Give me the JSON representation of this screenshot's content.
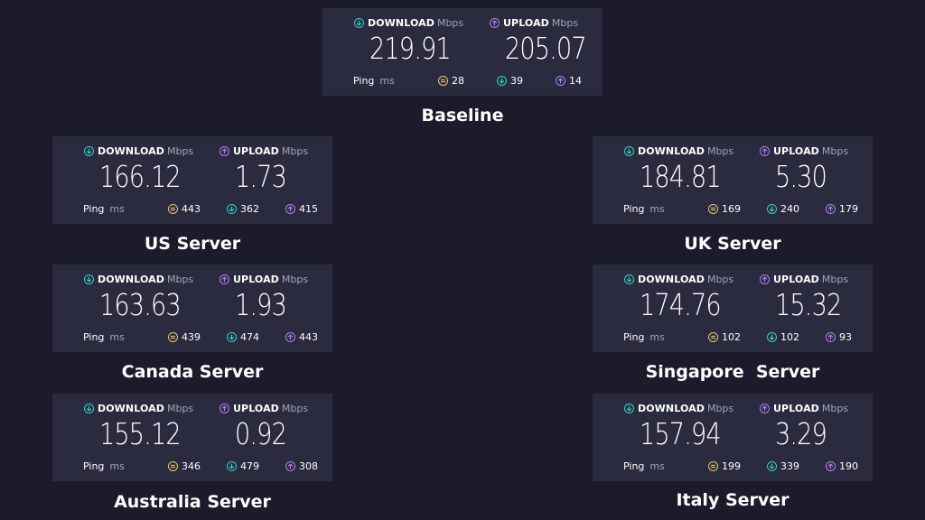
{
  "labels": {
    "download": "DOWNLOAD",
    "upload": "UPLOAD",
    "unit": "Mbps",
    "ping": "Ping",
    "ping_unit": "ms"
  },
  "colors": {
    "background": "#1b1b2c",
    "card": "#2a2b3f",
    "download_icon": "#35cfc7",
    "upload_icon": "#b57cf0",
    "jitter_icon": "#e9c46a"
  },
  "icons": {
    "download": "arrow-down-circle-icon",
    "upload": "arrow-up-circle-icon",
    "jitter": "jitter-icon"
  },
  "servers": [
    {
      "id": "baseline",
      "caption": "Baseline",
      "download": "219.91",
      "upload": "205.07",
      "ping_jitter": "28",
      "ping_download": "39",
      "ping_upload": "14"
    },
    {
      "id": "us",
      "caption": "US Server",
      "download": "166.12",
      "upload": "1.73",
      "ping_jitter": "443",
      "ping_download": "362",
      "ping_upload": "415"
    },
    {
      "id": "uk",
      "caption": "UK Server",
      "download": "184.81",
      "upload": "5.30",
      "ping_jitter": "169",
      "ping_download": "240",
      "ping_upload": "179"
    },
    {
      "id": "canada",
      "caption": "Canada Server",
      "download": "163.63",
      "upload": "1.93",
      "ping_jitter": "439",
      "ping_download": "474",
      "ping_upload": "443"
    },
    {
      "id": "singapore",
      "caption": "Singapore  Server",
      "download": "174.76",
      "upload": "15.32",
      "ping_jitter": "102",
      "ping_download": "102",
      "ping_upload": "93"
    },
    {
      "id": "australia",
      "caption": "Australia Server",
      "download": "155.12",
      "upload": "0.92",
      "ping_jitter": "346",
      "ping_download": "479",
      "ping_upload": "308"
    },
    {
      "id": "italy",
      "caption": "Italy Server",
      "download": "157.94",
      "upload": "3.29",
      "ping_jitter": "199",
      "ping_download": "339",
      "ping_upload": "190"
    }
  ]
}
